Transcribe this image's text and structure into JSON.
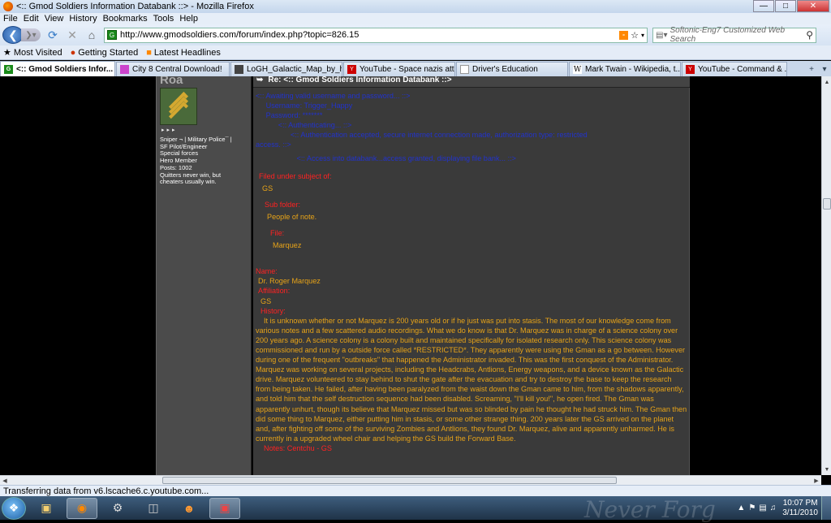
{
  "window": {
    "title": "<:: Gmod Soldiers Information Databank ::> - Mozilla Firefox",
    "minimize": "—",
    "maximize": "□",
    "close": "✕"
  },
  "menu": [
    "File",
    "Edit",
    "View",
    "History",
    "Bookmarks",
    "Tools",
    "Help"
  ],
  "nav": {
    "url": "http://www.gmodsoldiers.com/forum/index.php?topic=826.15",
    "search_placeholder": "Softonic-Eng7 Customized Web Search",
    "url_favicon": "G"
  },
  "bookmarks": [
    {
      "label": "Most Visited",
      "icon": "star-icon"
    },
    {
      "label": "Getting Started",
      "icon": "firefox-icon"
    },
    {
      "label": "Latest Headlines",
      "icon": "rss-icon"
    }
  ],
  "tabs": [
    {
      "label": "<:: Gmod Soldiers Infor...",
      "active": true,
      "fav": "G",
      "color": "#1a8a1a"
    },
    {
      "label": "City 8 Central Download!",
      "active": false,
      "fav": "",
      "color": "#cc44cc"
    },
    {
      "label": "LoGH_Galactic_Map_by_h...",
      "active": false,
      "fav": "",
      "color": "#444444"
    },
    {
      "label": "YouTube - Space nazis att...",
      "active": false,
      "fav": "Y",
      "color": "#cc0000"
    },
    {
      "label": "Driver's Education",
      "active": false,
      "fav": "",
      "color": "#ffffff"
    },
    {
      "label": "Mark Twain - Wikipedia, t...",
      "active": false,
      "fav": "W",
      "color": "#ffffff"
    },
    {
      "label": "YouTube - Command & ...",
      "active": false,
      "fav": "Y",
      "color": "#cc0000"
    }
  ],
  "status": "Transferring data from v6.lscache6.c.youtube.com...",
  "profile": {
    "username": "Roa",
    "lines": [
      "Sniper ¬ | Military Police¯ |",
      "SF Pilot/Engineer",
      "Special forces",
      "Hero Member",
      "Posts: 1002",
      "Quitters never win, but",
      "cheaters usually win."
    ]
  },
  "post": {
    "subject": "Re: <:: Gmod Soldiers Information Databank ::>",
    "login": [
      "<:: Awaiting valid username and password... ::>",
      "     Username: Trigger_Happy",
      "     Password: *******",
      "           <:: Authenticating... ::>",
      "                 <:: Authentication accepted, secure internet connection made, authorization type: restricted",
      "access. ::>",
      "                    <:: Access into databank...access granted, displaying file bank... ::>"
    ],
    "filed_label": "Filed under subject of:",
    "filed_value": "GS",
    "subfolder_label": "Sub folder:",
    "subfolder_value": "People of note.",
    "file_label": "File:",
    "file_value": "Marquez",
    "name_label": "Name:",
    "name_value": "Dr. Roger Marquez",
    "affiliation_label": "Affiliation:",
    "affiliation_value": "GS",
    "history_label": "History:",
    "history_text": "It is unknown whether or not Marquez is 200 years old or if he just was put into stasis. The most of our knowledge come from various notes and a few scattered audio recordings. What we do know is that Dr. Marquez was in charge of a science colony over 200 years ago. A science colony is a colony built and maintained specifically for isolated research only. This science colony was commissioned and run by a outside force called *RESTRICTED*. They apparently were using the Gman as a go between. However during one of the frequent \"outbreaks\" that happened the Administrator invaded. This was the first conquest of the Administrator. Marquez was working on several projects, including the Headcrabs, Antlions, Energy weapons, and a device known as the Galactic drive. Marquez volunteered to stay behind to shut the gate after the evacuation and try to destroy the base to keep the research from being taken. He failed, after having been paralyzed from the waist down the Gman came to him, from the shadows apparently, and told him that the self destruction sequence had been disabled. Screaming, \"I'll kill you!\", he open fired. The Gman was apparently unhurt, though its believe that Marquez missed but was so blinded by pain he thought he had struck him. The Gman then did some thing to Marquez, either putting him in stasis, or some other strange thing. 200 years later the GS arrived on the planet and, after fighting off some of the surviving Zombies and Antlions, they found Dr. Marquez, alive and apparently unharmed. He is currently in a upgraded wheel chair and helping the GS build the Forward Base.",
    "notes_label": "Notes: Centchu - GS"
  },
  "taskbar": {
    "time": "10:07 PM",
    "date": "3/11/2010",
    "wallpaper_text": "Never Forg"
  },
  "colors": {
    "login": "#2233cc",
    "labels": "#ff2222",
    "values": "#e7a318"
  }
}
